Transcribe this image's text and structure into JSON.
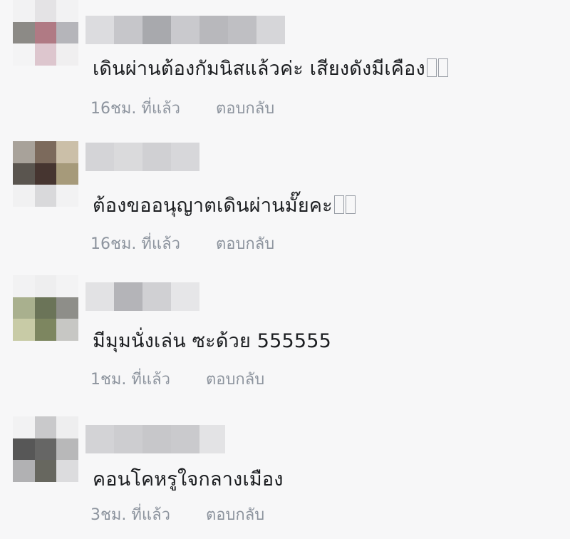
{
  "comments": [
    {
      "text": "เดินผ่านต้องกัมนิสแล้วค่ะ เสียงดังมีเคือง",
      "time": "16ชม. ที่แล้ว",
      "reply": "ตอบกลับ"
    },
    {
      "text": "ต้องขออนุญาตเดินผ่านมั๊ยคะ",
      "time": "16ชม. ที่แล้ว",
      "reply": "ตอบกลับ"
    },
    {
      "text": "มีมุมนั่งเล่น ซะด้วย 555555",
      "time": "1ชม. ที่แล้ว",
      "reply": "ตอบกลับ"
    },
    {
      "text": "คอนโคหรูใจกลางเมือง",
      "time": "3ชม. ที่แล้ว",
      "reply": "ตอบกลับ"
    }
  ]
}
